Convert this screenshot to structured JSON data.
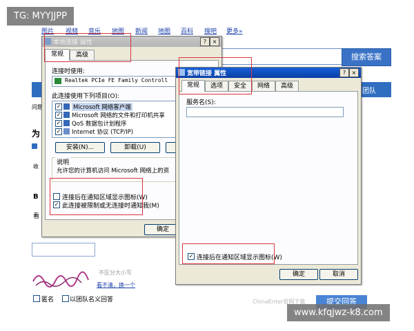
{
  "watermark_tg": "TG: MYYJJPP",
  "watermark_url": "www.kfqjwz-k8.com",
  "background_page": {
    "nav": [
      "图片",
      "视频",
      "音乐",
      "地图",
      "新闻",
      "地图",
      "百科",
      "搜吧",
      "更多»"
    ],
    "search_button": "搜索答案",
    "banner_right": "团队",
    "left_fragments": [
      "问题",
      "为",
      "收"
    ],
    "left_fragment_b": "B",
    "left_fragment_kan": "看",
    "captcha_hint_1": "不区分大小写",
    "captcha_hint_2": "看不清，换一个",
    "anonymous_label": "匿名",
    "team_anonymous_label": "以团队名义回答",
    "footer_faint": "ChinaEnter官网下载",
    "submit_button": "提交回答"
  },
  "dialog_local": {
    "title": "本地连接 属性",
    "title_buttons": [
      "?",
      "×"
    ],
    "tabs": [
      "常规",
      "高级"
    ],
    "connect_using_label": "连接时使用:",
    "adapter_name": "Realtek PCIe FE Family Controll",
    "components_label": "此连接使用下列项目(O):",
    "components": [
      {
        "label": "Microsoft 网络客户端",
        "checked": true,
        "selected": true
      },
      {
        "label": "Microsoft 网络的文件和打印机共享",
        "checked": true,
        "selected": false
      },
      {
        "label": "QoS 数据包计划程序",
        "checked": true,
        "selected": false
      },
      {
        "label": "Internet 协议 (TCP/IP)",
        "checked": true,
        "selected": false
      }
    ],
    "install_button": "安装(N)...",
    "uninstall_button": "卸载(U)",
    "description_heading": "说明",
    "description_text": "允许您的计算机访问 Microsoft 网络上的资",
    "show_icon_label": "连接后在通知区域显示图标(W)",
    "show_icon_checked": false,
    "notify_label": "此连接被限制或无连接时通知我(M)",
    "notify_checked": true,
    "ok_button": "确定"
  },
  "dialog_broadband": {
    "title": "宽带链接 属性",
    "title_buttons": [
      "?",
      "×"
    ],
    "tabs": [
      "常规",
      "选项",
      "安全",
      "网络",
      "高级"
    ],
    "service_name_label": "服务名(S):",
    "service_name_value": "",
    "show_icon_label": "连接后在通知区域显示图标(W)",
    "show_icon_checked": true,
    "ok_button": "确定",
    "cancel_button": "取消"
  },
  "colors": {
    "highlight_box": "#d9343a",
    "dialog_face": "#ece9d8",
    "page_blue": "#2f6dc0"
  }
}
